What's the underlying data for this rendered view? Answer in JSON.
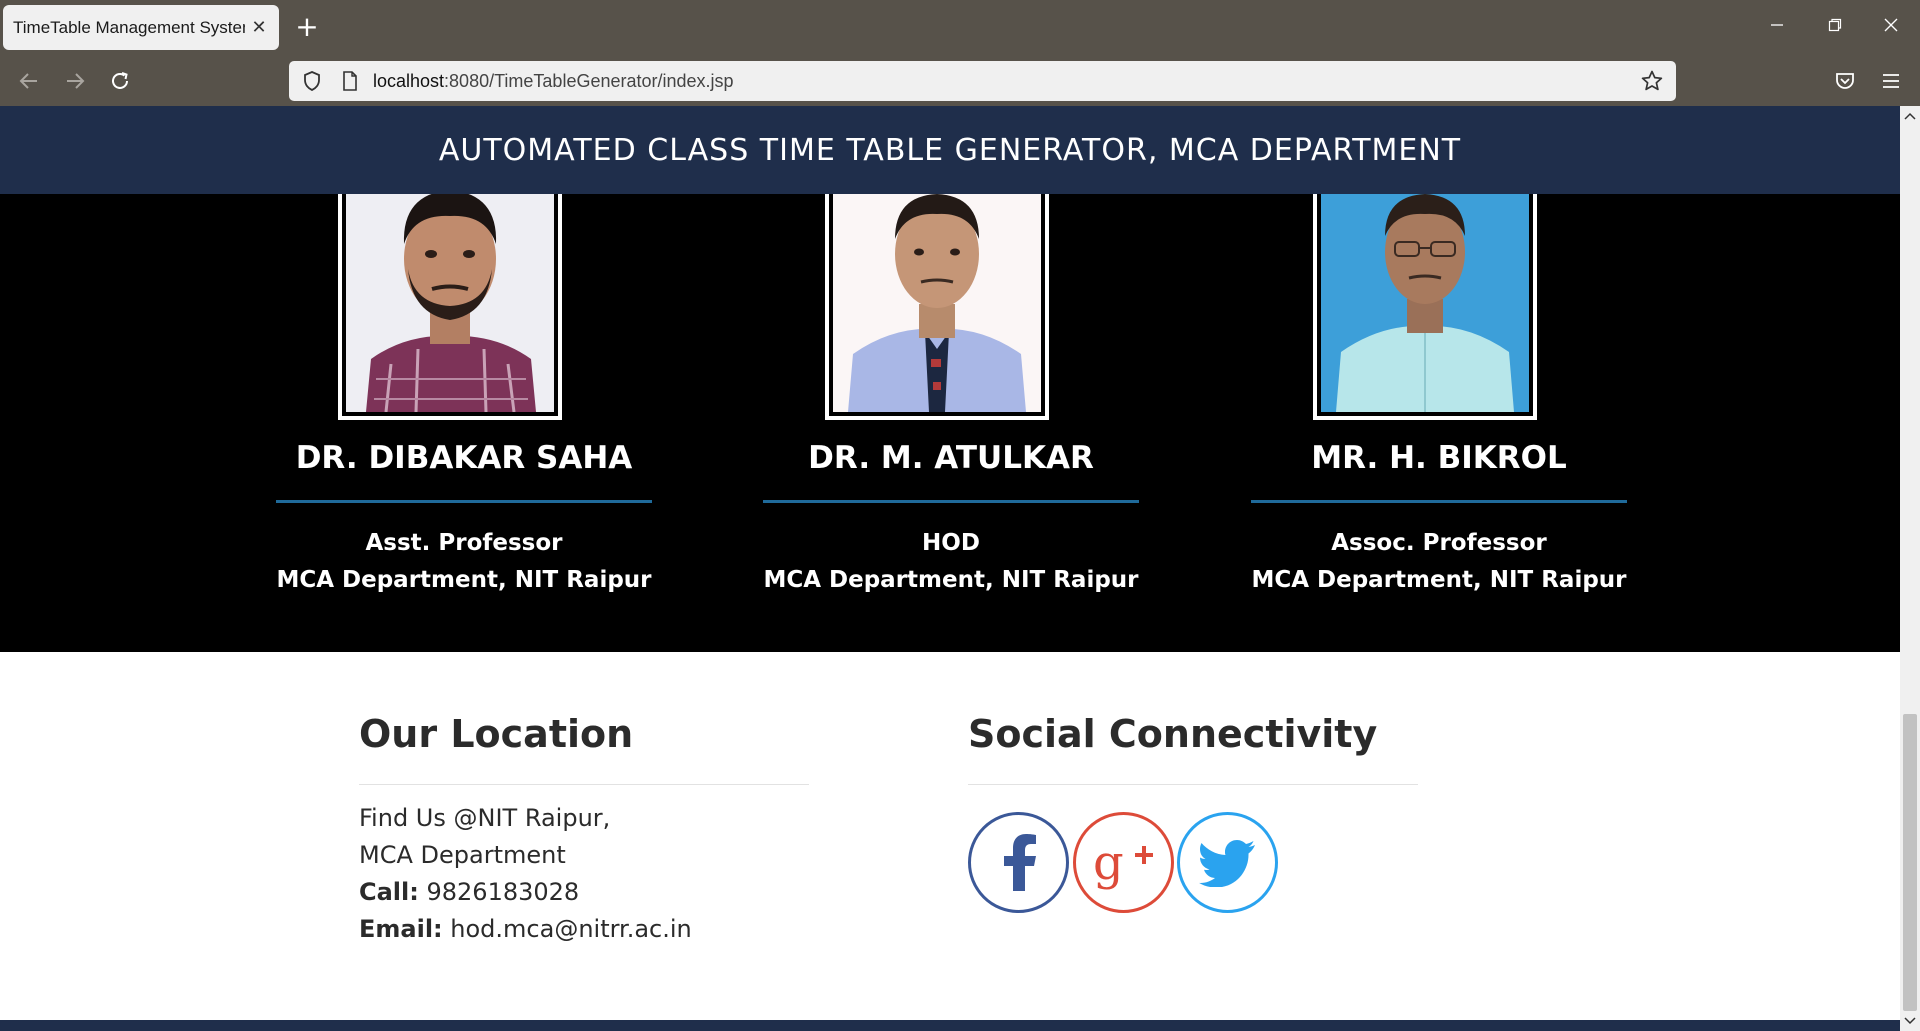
{
  "browser": {
    "tab_title": "TimeTable Management System",
    "tab_close": "✕",
    "new_tab": "+",
    "url_host": "localhost",
    "url_rest": ":8080/TimeTableGenerator/index.jsp"
  },
  "header": {
    "title": "AUTOMATED CLASS TIME TABLE GENERATOR, MCA DEPARTMENT"
  },
  "faculty": [
    {
      "name": "DR. DIBAKAR SAHA",
      "role": "Asst. Professor",
      "dept": "MCA Department, NIT Raipur"
    },
    {
      "name": "DR. M. ATULKAR",
      "role": "HOD",
      "dept": "MCA Department, NIT Raipur"
    },
    {
      "name": "MR. H. BIKROL",
      "role": "Assoc. Professor",
      "dept": "MCA Department, NIT Raipur"
    }
  ],
  "location": {
    "title": "Our Location",
    "line1": "Find Us @NIT Raipur,",
    "line2": "MCA Department",
    "call_label": "Call:",
    "call_value": " 9826183028",
    "email_label": "Email:",
    "email_value": " hod.mca@nitrr.ac.in"
  },
  "social": {
    "title": "Social Connectivity",
    "links": [
      "facebook",
      "google-plus",
      "twitter"
    ]
  },
  "colors": {
    "header_bg": "#1f2e4b",
    "faculty_bg": "#000000",
    "rule_blue": "#1f6a9a",
    "facebook": "#3b5898",
    "google_plus": "#dd4b39",
    "twitter": "#2aa3ef"
  }
}
